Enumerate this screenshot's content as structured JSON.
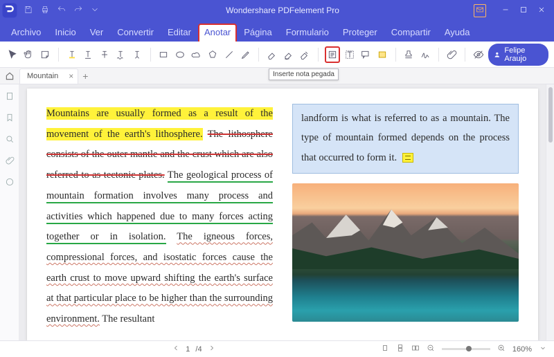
{
  "app": {
    "title": "Wondershare PDFelement Pro"
  },
  "menu": {
    "items": [
      "Archivo",
      "Inicio",
      "Ver",
      "Convertir",
      "Editar",
      "Anotar",
      "Página",
      "Formulario",
      "Proteger",
      "Compartir",
      "Ayuda"
    ],
    "active_index": 5
  },
  "toolbar": {
    "tooltip": "Inserte nota pegada",
    "icons": [
      "cursor",
      "hand",
      "sticky-note",
      "text-highlight",
      "text-underline",
      "text-strike",
      "text-squiggle",
      "text-caret",
      "rect",
      "oval",
      "cloud",
      "polygon",
      "line",
      "pencil",
      "eraser-1",
      "eraser-2",
      "eraser-3",
      "insert-note",
      "text-box",
      "callout",
      "area-highlight",
      "stamp",
      "signature",
      "attachment",
      "hide-annotations"
    ]
  },
  "user": {
    "name": "Felipe Araujo"
  },
  "tabs": {
    "items": [
      {
        "label": "Mountain"
      }
    ]
  },
  "doc": {
    "left": {
      "seg_hl": "Mountains are usually formed as a result of the movement of the earth's lithosphere.",
      "seg_strike": "The lithosphere consists of the outer mantle and the crust which are also referred to as tectonic plates.",
      "seg_green": "The geological process of mountain formation involves many process and activities which happened due to many forces acting together or in isolation.",
      "seg_squiggle": "The igneous forces, compressional forces, and isostatic forces cause the earth crust to move upward shifting the earth's surface at that particular place to be higher than the surrounding environment.",
      "seg_tail": "The resultant"
    },
    "right": {
      "selected": "landform is what is referred to as a mountain. The type of mountain formed depends on the process that occurred to form it."
    }
  },
  "status": {
    "page_current": "1",
    "page_sep": "/4",
    "zoom": "160%"
  }
}
